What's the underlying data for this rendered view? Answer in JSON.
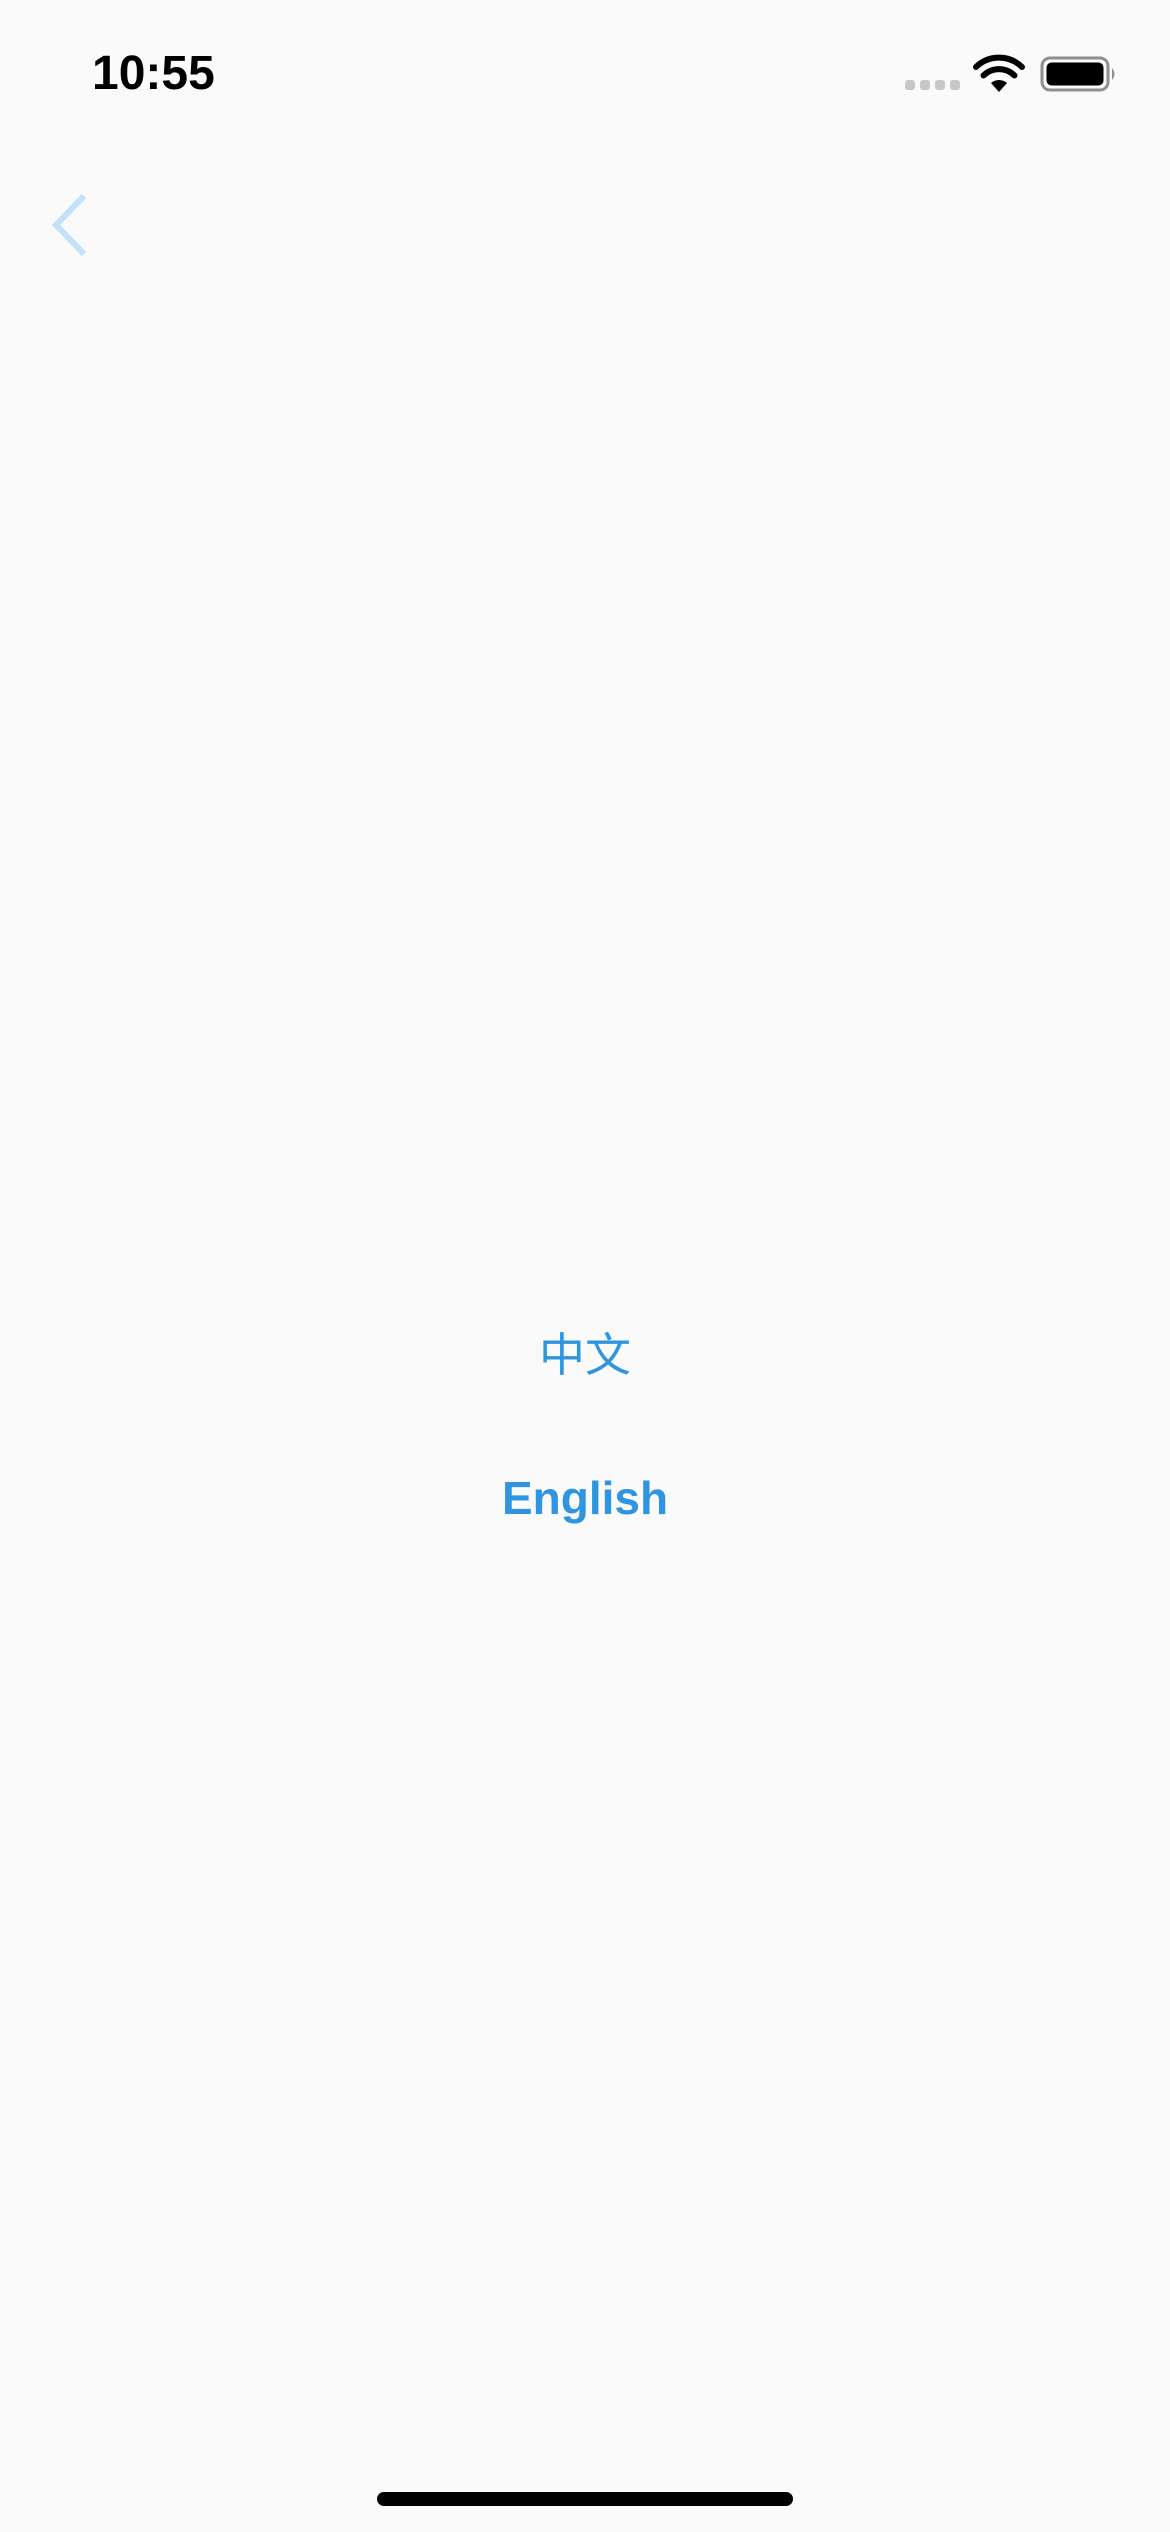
{
  "status_bar": {
    "time": "10:55",
    "signal_icon": "cellular-signal-icon",
    "wifi_icon": "wifi-icon",
    "battery_icon": "battery-icon"
  },
  "nav": {
    "back_icon": "chevron-left-icon",
    "back_color": "#c4e1fb"
  },
  "languages": [
    {
      "label": "中文"
    },
    {
      "label": "English"
    }
  ],
  "colors": {
    "background": "#fafafa",
    "accent": "#2f95e0",
    "text": "#000000"
  }
}
